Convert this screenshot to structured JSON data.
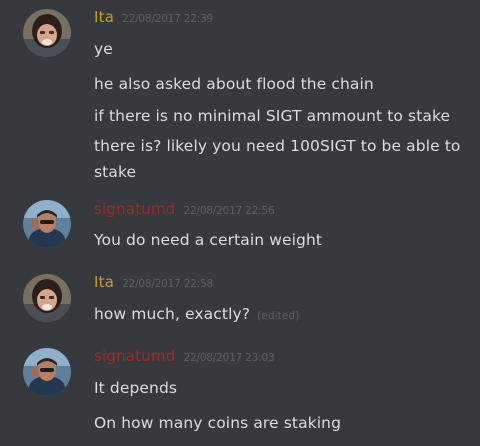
{
  "colors": {
    "background": "#36393e",
    "ita_name": "#c69a2d",
    "signatumd_name": "#a02a27",
    "message_text": "#dcddde",
    "timestamp": "#5d6066"
  },
  "groups": [
    {
      "username": "Ita",
      "timestamp": "22/08/2017 22:39",
      "avatar": "ita-avatar",
      "messages": [
        "ye",
        "he also asked about  flood the chain",
        "if there is no minimal SIGT ammount to stake",
        "there is? likely you need 100SIGT to be able to stake"
      ]
    },
    {
      "username": "signatumd",
      "timestamp": "22/08/2017 22:56",
      "avatar": "signatumd-avatar",
      "messages": [
        "You do need a certain weight"
      ]
    },
    {
      "username": "Ita",
      "timestamp": "22/08/2017 22:58",
      "avatar": "ita-avatar",
      "messages": [
        "how much, exactly?"
      ],
      "edited_label": "(edited)"
    },
    {
      "username": "signatumd",
      "timestamp": "22/08/2017 23:03",
      "avatar": "signatumd-avatar",
      "messages": [
        "It depends",
        "On how many coins are staking"
      ]
    }
  ]
}
